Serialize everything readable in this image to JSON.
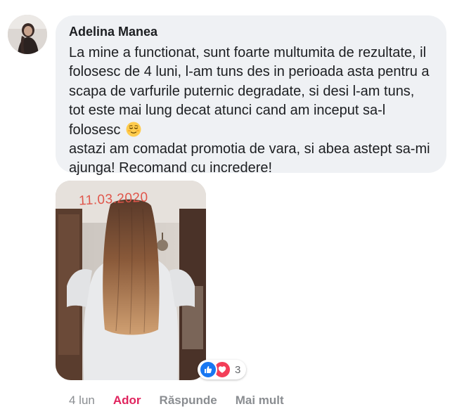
{
  "comment": {
    "author": "Adelina Manea",
    "text": "La mine a functionat, sunt foarte multumita de rezultate, il folosesc de 4 luni, l-am tuns des in perioada asta pentru a scapa de varfurile puternic degradate, si desi l-am tuns, tot este mai lung decat atunci cand am inceput sa-l folosesc",
    "text_after_emoji": "astazi am comadat promotia de vara, si abea astept sa-mi ajunga! Recomand cu incredere!",
    "emoji": "relieved-face-icon"
  },
  "photo": {
    "date_stamp": "11.03.2020"
  },
  "reactions": {
    "icons": [
      "like-icon",
      "love-icon"
    ],
    "count": "3"
  },
  "actions": {
    "time": "4 lun",
    "reaction_label": "Ador",
    "reply_label": "Răspunde",
    "more_label": "Mai mult"
  },
  "colors": {
    "bubble": "#eff1f4",
    "text": "#1c1e21",
    "muted": "#8a8d91",
    "ador": "#e0245e",
    "like": "#1877f2",
    "love": "#f33e58"
  }
}
